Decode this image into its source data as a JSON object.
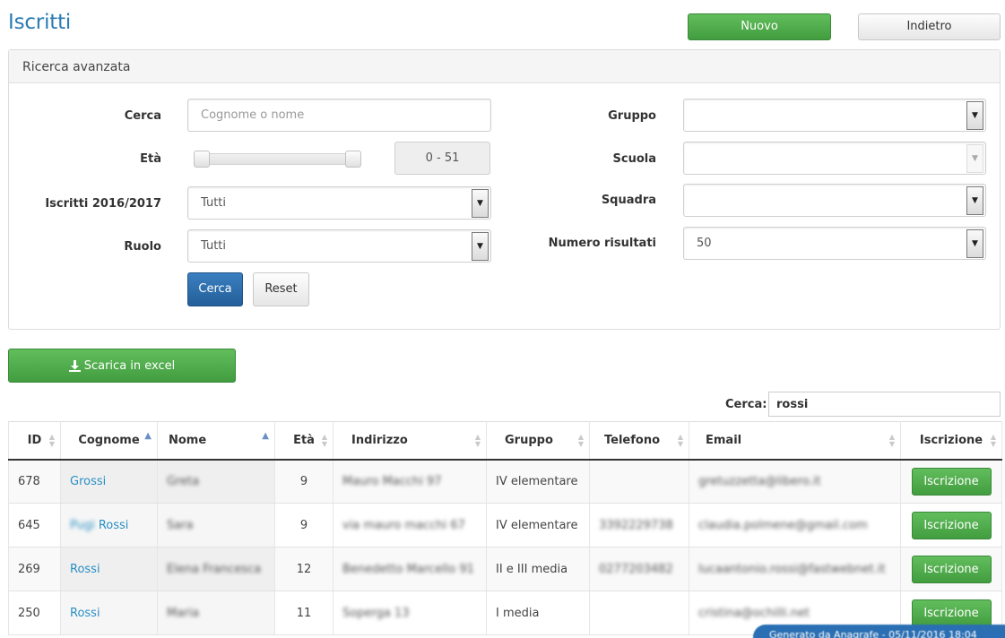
{
  "page": {
    "title": "Iscritti"
  },
  "header": {
    "new_label": "Nuovo",
    "back_label": "Indietro"
  },
  "advanced_search": {
    "title": "Ricerca avanzata",
    "search": {
      "label": "Cerca",
      "placeholder": "Cognome o nome",
      "value": ""
    },
    "age": {
      "label": "Età",
      "range_text": "0 - 51",
      "min": 0,
      "max": 51
    },
    "enrolled": {
      "label": "Iscritti 2016/2017",
      "value": "Tutti"
    },
    "role": {
      "label": "Ruolo",
      "value": "Tutti"
    },
    "group": {
      "label": "Gruppo",
      "value": ""
    },
    "school": {
      "label": "Scuola",
      "value": ""
    },
    "team": {
      "label": "Squadra",
      "value": ""
    },
    "results_count": {
      "label": "Numero risultati",
      "value": "50"
    },
    "search_button": "Cerca",
    "reset_button": "Reset"
  },
  "export": {
    "excel_label": "Scarica in excel",
    "icon": "download-icon"
  },
  "table_search": {
    "label": "Cerca:",
    "value": "rossi"
  },
  "table": {
    "columns": [
      "ID",
      "Cognome",
      "Nome",
      "Età",
      "Indirizzo",
      "Gruppo",
      "Telefono",
      "Email",
      "Iscrizione"
    ],
    "rows": [
      {
        "id": "678",
        "cognome": "Grossi",
        "nome": "Greta",
        "eta": "9",
        "indirizzo": "Mauro Macchi 97",
        "gruppo": "IV elementare",
        "telefono": "",
        "email": "gretuzzetta@libero.it",
        "action": "Iscrizione"
      },
      {
        "id": "645",
        "cognome_pre": "Pugi",
        "cognome": "Rossi",
        "nome": "Sara",
        "eta": "9",
        "indirizzo": "via mauro macchi 67",
        "gruppo": "IV elementare",
        "telefono": "3392229738",
        "email": "claudia.polmene@gmail.com",
        "action": "Iscrizione"
      },
      {
        "id": "269",
        "cognome": "Rossi",
        "nome": "Elena Francesca",
        "eta": "12",
        "indirizzo": "Benedetto Marcello 91",
        "gruppo": "II e III media",
        "telefono": "0277203482",
        "email": "lucaantonio.rossi@fastwebnet.it",
        "action": "Iscrizione"
      },
      {
        "id": "250",
        "cognome": "Rossi",
        "nome": "Maria",
        "eta": "11",
        "indirizzo": "Soperga 13",
        "gruppo": "I media",
        "telefono": "",
        "email": "cristina@ochilli.net",
        "action": "Iscrizione"
      }
    ]
  },
  "footer_bubble": {
    "text": "Generato da Anagrafe - 05/11/2016 18:04"
  }
}
